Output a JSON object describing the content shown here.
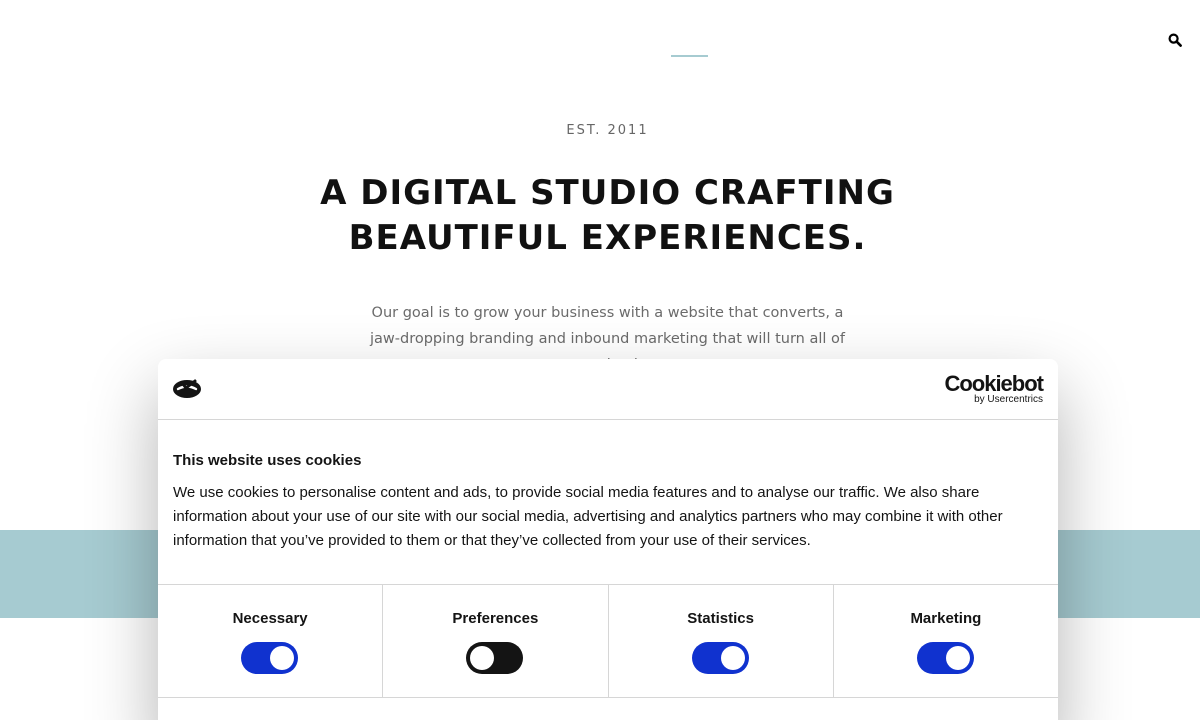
{
  "header": {
    "search_icon": "search-icon"
  },
  "hero": {
    "est": "EST. 2011",
    "title_line1": "A DIGITAL STUDIO CRAFTING",
    "title_line2": "BEAUTIFUL EXPERIENCES.",
    "text": "Our goal is to grow your business with a website that converts, a jaw-dropping branding and inbound marketing that will turn all of your leads"
  },
  "colors": {
    "accent": "#a6cbd1",
    "toggle_on": "#1032cf",
    "toggle_off": "#141414"
  },
  "cookie_banner": {
    "brand_name": "Cookiebot",
    "brand_sub": "by Usercentrics",
    "title": "This website uses cookies",
    "text": "We use cookies to personalise content and ads, to provide social media features and to analyse our traffic. We also share information about your use of our site with our social media, advertising and analytics partners who may combine it with other information that you’ve provided to them or that they’ve collected from your use of their services.",
    "categories": [
      {
        "label": "Necessary",
        "enabled": true
      },
      {
        "label": "Preferences",
        "enabled": false
      },
      {
        "label": "Statistics",
        "enabled": true
      },
      {
        "label": "Marketing",
        "enabled": true
      }
    ]
  }
}
